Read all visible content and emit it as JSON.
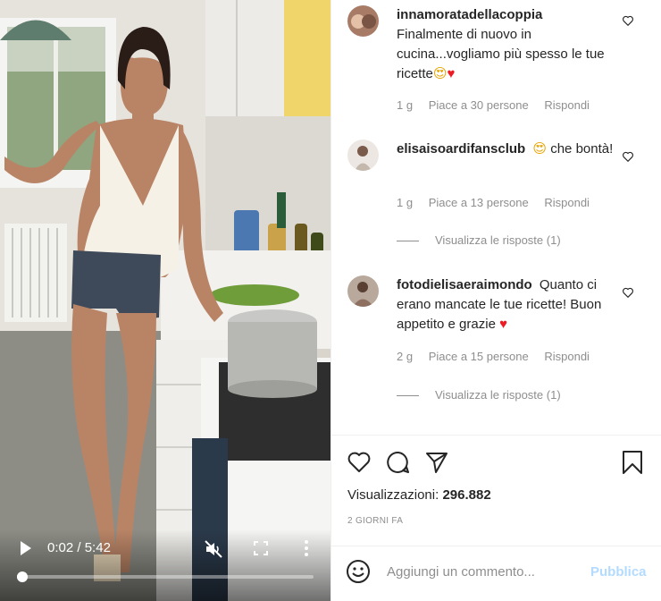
{
  "video": {
    "time_current": "0:02",
    "time_total": "5:42",
    "progress": 0.006
  },
  "comments": [
    {
      "username": "innamoratadellacoppia",
      "text": "Finalmente di nuovo in cucina...vogliamo più spesso le tue ricette",
      "emojis": [
        "😍",
        "♥"
      ],
      "age": "1 g",
      "likes": "Piace a 30 persone",
      "reply": "Rispondi"
    },
    {
      "username": "elisaisoardifansclub",
      "text_pre_emoji": "😍",
      "text": "che bontà!",
      "age": "1 g",
      "likes": "Piace a 13 persone",
      "reply": "Rispondi",
      "view_replies": "Visualizza le risposte (1)"
    },
    {
      "username": "fotodielisaeraimondo",
      "text": "Quanto ci erano mancate le tue ricette! Buon appetito e grazie",
      "emojis": [
        "♥"
      ],
      "age": "2 g",
      "likes": "Piace a 15 persone",
      "reply": "Rispondi",
      "view_replies": "Visualizza le risposte (1)"
    }
  ],
  "actions": {
    "icons": [
      "heart-icon",
      "comment-icon",
      "share-icon",
      "bookmark-icon"
    ],
    "views_label": "Visualizzazioni:",
    "views_count": "296.882",
    "date": "2 GIORNI FA"
  },
  "add_comment": {
    "placeholder": "Aggiungi un commento...",
    "publish_label": "Pubblica"
  },
  "colors": {
    "accent_disabled": "#b3dbff",
    "heart": "#ed1c24",
    "muted_text": "#8e8e8e"
  }
}
